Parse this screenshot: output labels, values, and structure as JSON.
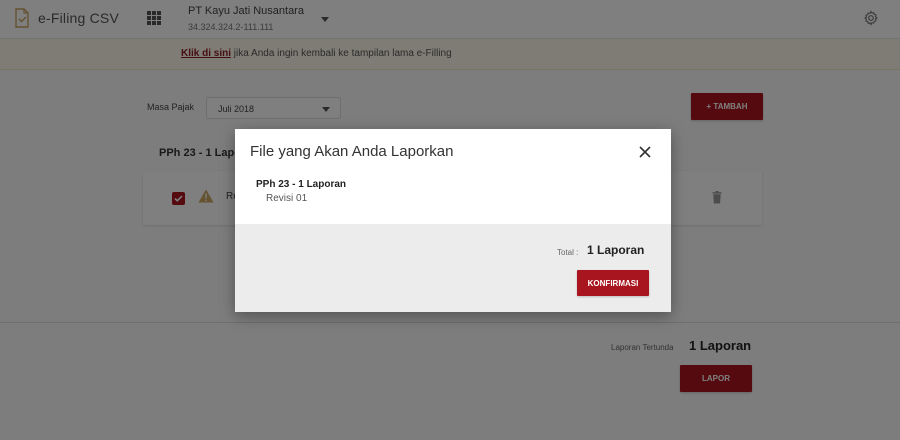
{
  "header": {
    "app_name": "e-Filing CSV",
    "company_name": "PT Kayu Jati Nusantara",
    "company_npwp": "34.324.324.2-111.111",
    "icons": {
      "logo": "document-check-icon",
      "apps": "grid-icon",
      "settings": "gear-icon",
      "company_menu": "caret-down-icon"
    }
  },
  "notice": {
    "link_text": "Klik di sini",
    "text": " jika Anda ingin kembali ke tampilan lama e-Filling"
  },
  "filters": {
    "masa_pajak_label": "Masa Pajak",
    "masa_pajak_value": "Juli 2018"
  },
  "toolbar": {
    "tambah_label": "+ TAMBAH"
  },
  "section": {
    "title": "PPh 23 - 1 Laporan",
    "row_text": "Re"
  },
  "footer": {
    "pending_label": "Laporan Tertunda",
    "pending_value": "1 Laporan",
    "lapor_label": "LAPOR"
  },
  "modal": {
    "title": "File yang Akan Anda Laporkan",
    "item_title": "PPh 23 - 1 Laporan",
    "item_sub": "Revisi 01",
    "total_label": "Total :",
    "total_value": "1 Laporan",
    "confirm_label": "KONFIRMASI"
  },
  "colors": {
    "accent": "#a8151f",
    "notice_bg": "#fdf8e8",
    "warning": "#c9a463"
  }
}
